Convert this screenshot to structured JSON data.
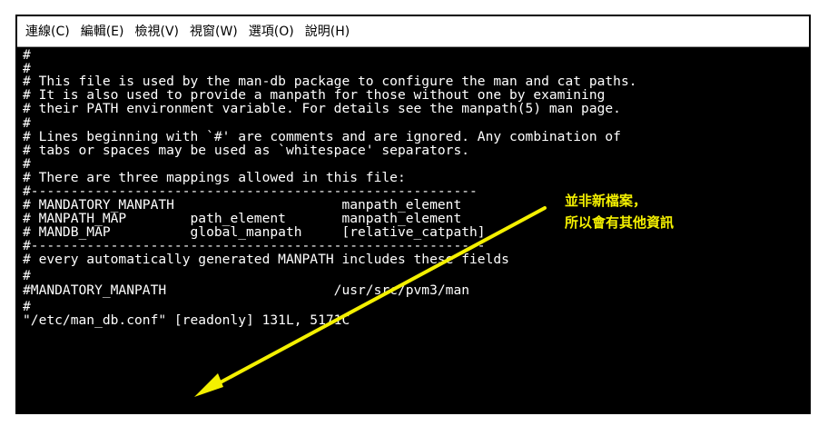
{
  "menu": {
    "items": [
      "連線(C)",
      "編輯(E)",
      "檢視(V)",
      "視窗(W)",
      "選項(O)",
      "說明(H)"
    ]
  },
  "terminal": {
    "lines": [
      "#",
      "#",
      "# This file is used by the man-db package to configure the man and cat paths.",
      "# It is also used to provide a manpath for those without one by examining",
      "# their PATH environment variable. For details see the manpath(5) man page.",
      "#",
      "# Lines beginning with `#' are comments and are ignored. Any combination of",
      "# tabs or spaces may be used as `whitespace' separators.",
      "#",
      "# There are three mappings allowed in this file:",
      "#--------------------------------------------------------",
      "# MANDATORY_MANPATH                     manpath_element",
      "# MANPATH_MAP        path_element       manpath_element",
      "# MANDB_MAP          global_manpath     [relative_catpath]",
      "#---------------------------------------------------------",
      "# every automatically generated MANPATH includes these fields",
      "#",
      "#MANDATORY_MANPATH                     /usr/src/pvm3/man",
      "#",
      "\"/etc/man_db.conf\" [readonly] 131L, 5171C"
    ],
    "text_color": "#ffffff",
    "background_color": "#000000"
  },
  "annotation": {
    "line1": "並非新檔案，",
    "line2": "所以會有其他資訊",
    "color": "#f4f000"
  }
}
